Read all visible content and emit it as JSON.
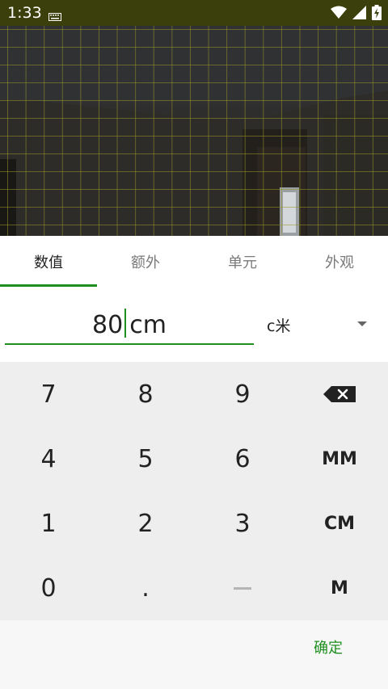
{
  "status_bar": {
    "time": "1:33",
    "icons": [
      "keyboard-icon",
      "wifi-icon",
      "cell-signal-icon",
      "battery-charging-icon"
    ]
  },
  "tabs": [
    {
      "label": "数值",
      "active": true
    },
    {
      "label": "额外",
      "active": false
    },
    {
      "label": "单元",
      "active": false
    },
    {
      "label": "外观",
      "active": false
    }
  ],
  "input": {
    "value": "80",
    "suffix": "cm",
    "unit_selected": "c米"
  },
  "keypad": {
    "rows": [
      [
        "7",
        "8",
        "9",
        "backspace"
      ],
      [
        "4",
        "5",
        "6",
        "MM"
      ],
      [
        "1",
        "2",
        "3",
        "CM"
      ],
      [
        "0",
        ".",
        "—",
        "M"
      ]
    ]
  },
  "footer": {
    "confirm_label": "确定"
  },
  "colors": {
    "accent": "#1e8f1e",
    "status_bar": "#3b3f0c",
    "keypad_bg": "#eeeeee"
  }
}
